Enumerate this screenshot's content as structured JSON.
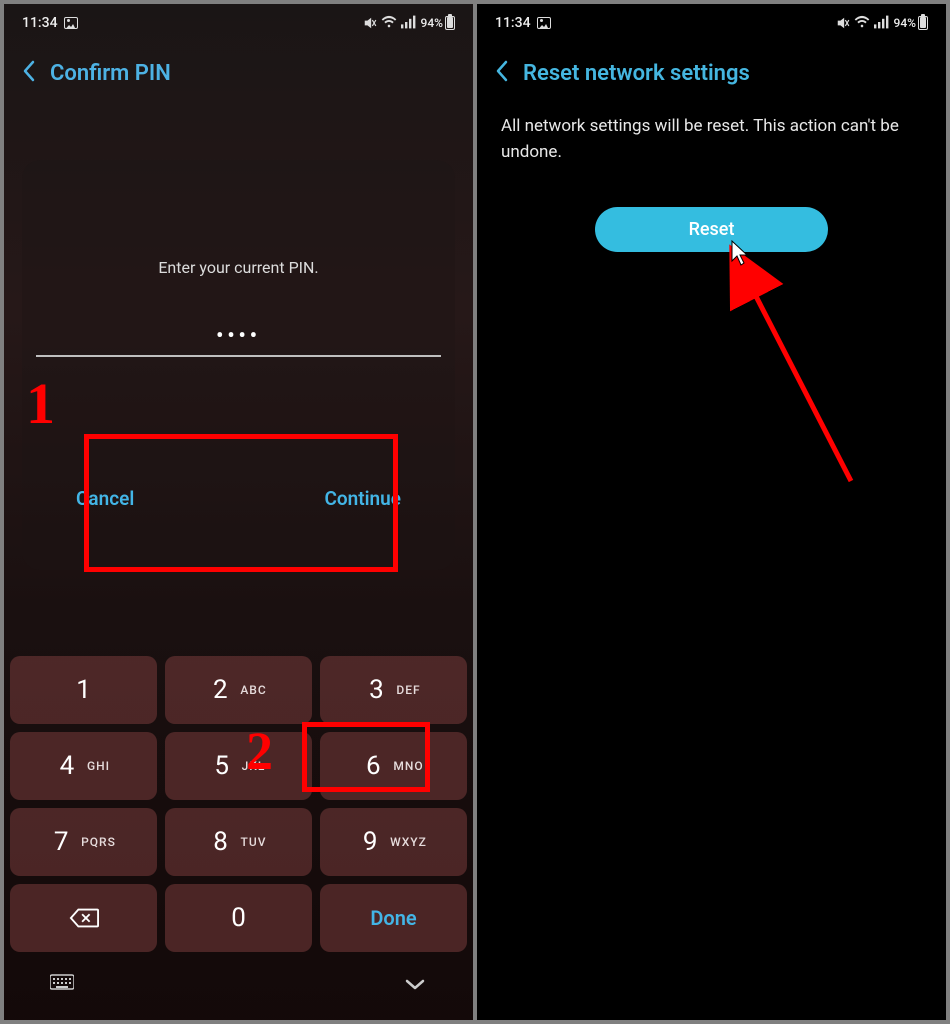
{
  "status": {
    "time": "11:34",
    "battery_text": "94%"
  },
  "left": {
    "header_title": "Confirm PIN",
    "pin_prompt": "Enter your current PIN.",
    "pin_mask": "••••",
    "cancel_label": "Cancel",
    "continue_label": "Continue",
    "annotation_1": "1",
    "annotation_2": "2",
    "keypad": [
      {
        "num": "1",
        "sub": ""
      },
      {
        "num": "2",
        "sub": "ABC"
      },
      {
        "num": "3",
        "sub": "DEF"
      },
      {
        "num": "4",
        "sub": "GHI"
      },
      {
        "num": "5",
        "sub": "JKL"
      },
      {
        "num": "6",
        "sub": "MNO"
      },
      {
        "num": "7",
        "sub": "PQRS"
      },
      {
        "num": "8",
        "sub": "TUV"
      },
      {
        "num": "9",
        "sub": "WXYZ"
      }
    ],
    "key_zero": "0",
    "done_label": "Done"
  },
  "right": {
    "header_title": "Reset network settings",
    "description": "All network settings will be reset. This action can't be undone.",
    "reset_label": "Reset"
  }
}
